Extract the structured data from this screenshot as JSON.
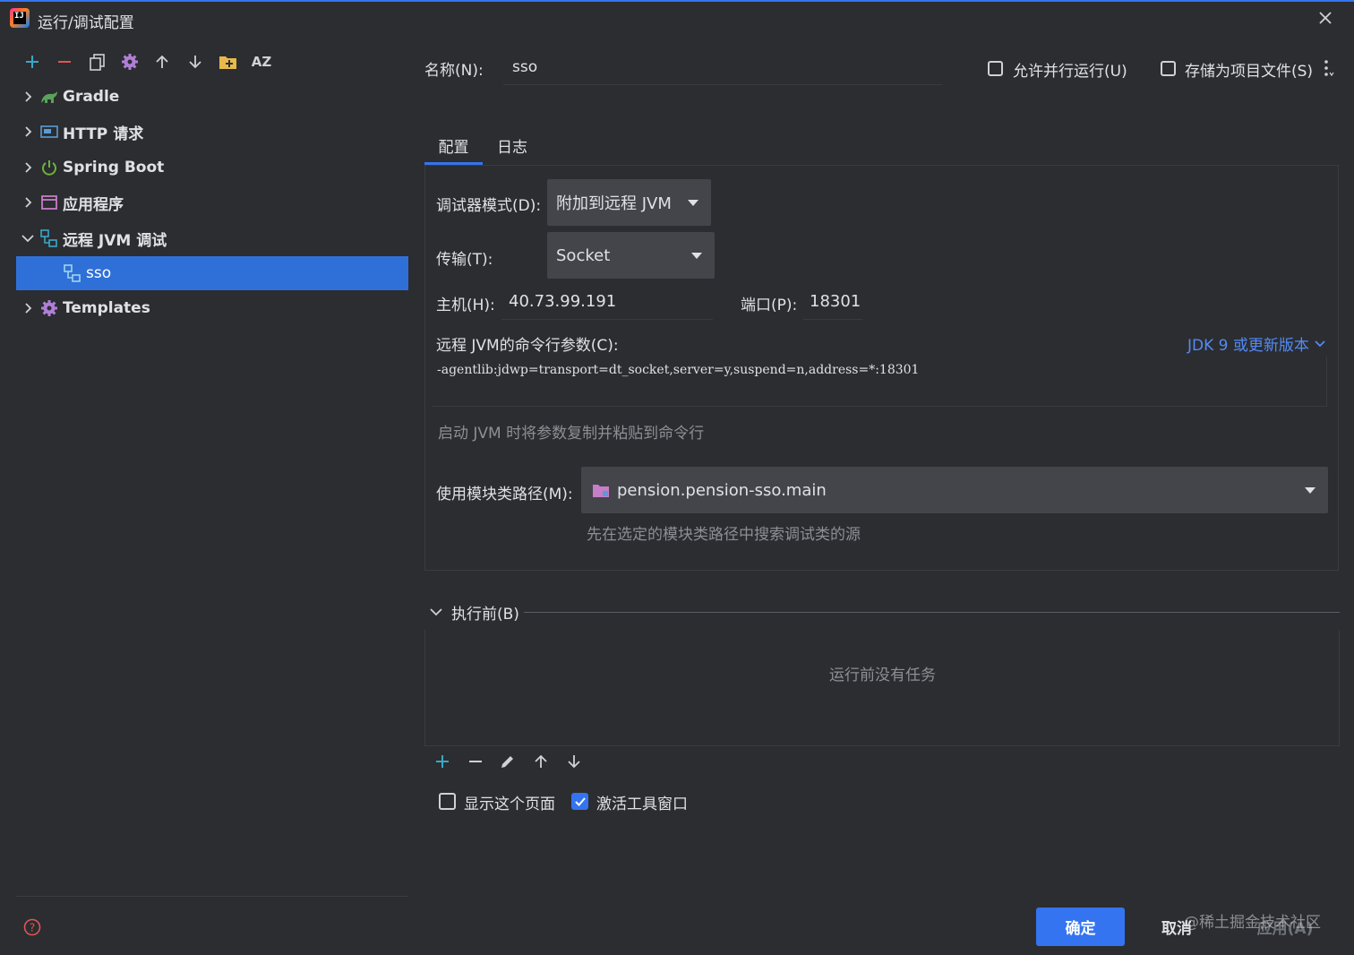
{
  "window": {
    "title": "运行/调试配置",
    "close_icon": "close-icon"
  },
  "toolbar": {
    "icons": [
      "add-icon",
      "remove-icon",
      "copy-icon",
      "settings-icon",
      "move-up-icon",
      "move-down-icon",
      "new-folder-icon",
      "sort-az-icon"
    ],
    "sort_label": "AZ"
  },
  "tree": {
    "items": [
      {
        "label": "Gradle",
        "icon": "gradle-icon",
        "expanded": false
      },
      {
        "label": "HTTP 请求",
        "icon": "http-request-icon",
        "expanded": false
      },
      {
        "label": "Spring Boot",
        "icon": "spring-boot-icon",
        "expanded": false
      },
      {
        "label": "应用程序",
        "icon": "application-icon",
        "expanded": false
      },
      {
        "label": "远程 JVM 调试",
        "icon": "remote-jvm-debug-icon",
        "expanded": true
      },
      {
        "label": "sso",
        "icon": "remote-jvm-debug-icon",
        "selected": true
      },
      {
        "label": "Templates",
        "icon": "templates-gear-icon",
        "expanded": false
      }
    ]
  },
  "header": {
    "name_label": "名称(N):",
    "name_value": "sso",
    "allow_parallel_label": "允许并行运行(U)",
    "allow_parallel_checked": false,
    "store_as_project_label": "存储为项目文件(S)",
    "store_as_project_checked": false
  },
  "tabs": [
    {
      "label": "配置",
      "active": true
    },
    {
      "label": "日志",
      "active": false
    }
  ],
  "config": {
    "debugger_mode_label": "调试器模式(D):",
    "debugger_mode_value": "附加到远程 JVM",
    "transport_label": "传输(T):",
    "transport_value": "Socket",
    "host_label": "主机(H):",
    "host_value": "40.73.99.191",
    "port_label": "端口(P):",
    "port_value": "18301",
    "cmdline_label": "远程 JVM的命令行参数(C):",
    "jdk_link": "JDK 9 或更新版本",
    "cmdline_value": "-agentlib:jdwp=transport=dt_socket,server=y,suspend=n,address=*:18301",
    "cmdline_hint": "启动 JVM 时将参数复制并粘贴到命令行",
    "module_label": "使用模块类路径(M):",
    "module_value": "pension.pension-sso.main",
    "module_hint": "先在选定的模块类路径中搜索调试类的源"
  },
  "before_launch": {
    "title": "执行前(B)",
    "empty_text": "运行前没有任务",
    "toolbar_icons": [
      "add-icon",
      "remove-icon",
      "edit-icon",
      "move-up-icon",
      "move-down-icon"
    ],
    "show_page_label": "显示这个页面",
    "show_page_checked": false,
    "activate_tool_window_label": "激活工具窗口",
    "activate_tool_window_checked": true
  },
  "footer": {
    "ok_label": "确定",
    "cancel_label": "取消",
    "apply_label": "应用(A)",
    "watermark": "@稀土掘金技术社区",
    "help_icon": "help-icon"
  },
  "colors": {
    "accent": "#3574f0",
    "selection": "#2e70d8",
    "background": "#2b2d30",
    "link": "#548af7"
  }
}
